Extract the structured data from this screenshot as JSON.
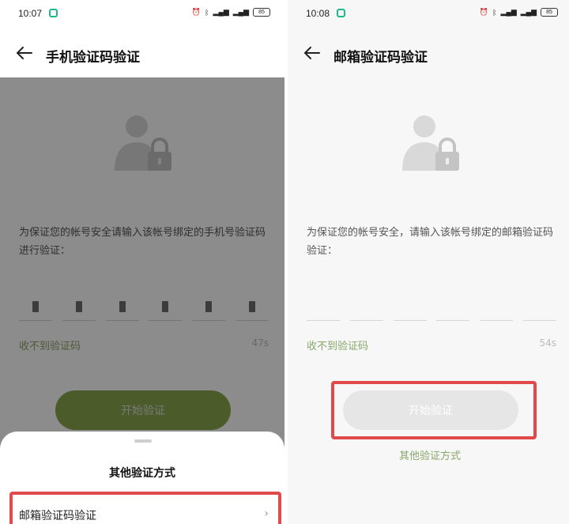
{
  "left": {
    "status": {
      "time": "10:07",
      "battery": "85"
    },
    "header": {
      "title": "手机验证码验证"
    },
    "description": "为保证您的帐号安全请输入该帐号绑定的手机号验证码进行验证：",
    "code_cells": 6,
    "resend": "收不到验证码",
    "countdown": "47s",
    "start_button": "开始验证",
    "sheet": {
      "title": "其他验证方式",
      "option": "邮箱验证码验证",
      "chevron": "›"
    }
  },
  "right": {
    "status": {
      "time": "10:08",
      "battery": "85"
    },
    "header": {
      "title": "邮箱验证码验证"
    },
    "description": "为保证您的帐号安全，请输入该帐号绑定的邮箱验证码验证：",
    "code_cells": 6,
    "resend": "收不到验证码",
    "countdown": "54s",
    "start_button": "开始验证",
    "other_methods": "其他验证方式"
  },
  "colors": {
    "accent": "#8ba74e",
    "highlight": "#e04a4a",
    "link": "#8aa66a"
  }
}
